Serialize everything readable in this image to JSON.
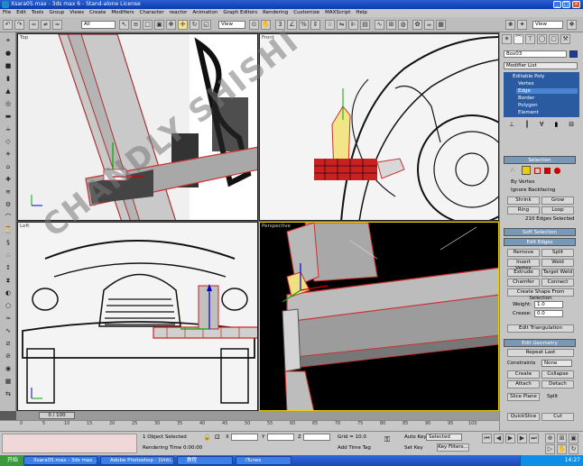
{
  "window": {
    "title": "Xsara05.max - 3ds max 6 - Stand-alone License",
    "min": "_",
    "max": "□",
    "close": "×"
  },
  "menu": [
    "File",
    "Edit",
    "Tools",
    "Group",
    "Views",
    "Create",
    "Modifiers",
    "Character",
    "reactor",
    "Animation",
    "Graph Editors",
    "Rendering",
    "Customize",
    "MAXScript",
    "Help"
  ],
  "toolbar": {
    "selection_filter": "All",
    "ref_coord": "View",
    "named_sel": "View"
  },
  "viewports": {
    "top": "Top",
    "front": "Front",
    "left": "Left",
    "perspective": "Perspective"
  },
  "watermark": "CHANDLY SHISHI",
  "command_panel": {
    "object_name": "Box03",
    "modifier_list": "Modifier List",
    "stack": [
      "Editable Poly",
      "Vertex",
      "Edge",
      "Border",
      "Polygon",
      "Element"
    ],
    "stack_selected": "Edge",
    "selection": {
      "title": "Selection",
      "by_vertex": "By Vertex",
      "ignore_backfacing": "Ignore Backfacing",
      "shrink": "Shrink",
      "grow": "Grow",
      "ring": "Ring",
      "loop": "Loop",
      "status": "210 Edges Selected"
    },
    "soft_selection": "Soft Selection",
    "edit_edges": {
      "title": "Edit Edges",
      "remove": "Remove",
      "split": "Split",
      "insert_vertex": "Insert Vertex",
      "weld": "Weld",
      "extrude": "Extrude",
      "target_weld": "Target Weld",
      "chamfer": "Chamfer",
      "connect": "Connect",
      "create_shape": "Create Shape From Selection",
      "weight_label": "Weight:",
      "weight": "1.0",
      "crease_label": "Crease:",
      "crease": "0.0",
      "edit_tri": "Edit Triangulation"
    },
    "edit_geometry": {
      "title": "Edit Geometry",
      "repeat_last": "Repeat Last",
      "constraints_label": "Constraints",
      "constraints": "None",
      "create": "Create",
      "collapse": "Collapse",
      "attach": "Attach",
      "detach": "Detach",
      "slice_plane": "Slice Plane",
      "split": "Split",
      "quickslice": "QuickSlice",
      "cut": "Cut"
    }
  },
  "timeline": {
    "frame": "0 / 100",
    "ticks": [
      "0",
      "5",
      "10",
      "15",
      "20",
      "25",
      "30",
      "35",
      "40",
      "45",
      "50",
      "55",
      "60",
      "65",
      "70",
      "75",
      "80",
      "85",
      "90",
      "95",
      "100"
    ]
  },
  "status": {
    "selected": "1 Object Selected",
    "render_time": "Rendering Time  0:00:00",
    "x_label": "X",
    "y_label": "Y",
    "z_label": "Z",
    "grid": "Grid = 10.0",
    "add_time_tag": "Add Time Tag",
    "auto_key": "Auto Key",
    "set_key": "Set Key",
    "key_filters": "Key Filters...",
    "selected_dd": "Selected"
  },
  "taskbar": {
    "start": "开始",
    "tasks": [
      "Xsara05.max - 3ds max ...",
      "Adobe Photoshop - [Unti...",
      "教程",
      "iTunes"
    ],
    "clock": "14:27"
  }
}
